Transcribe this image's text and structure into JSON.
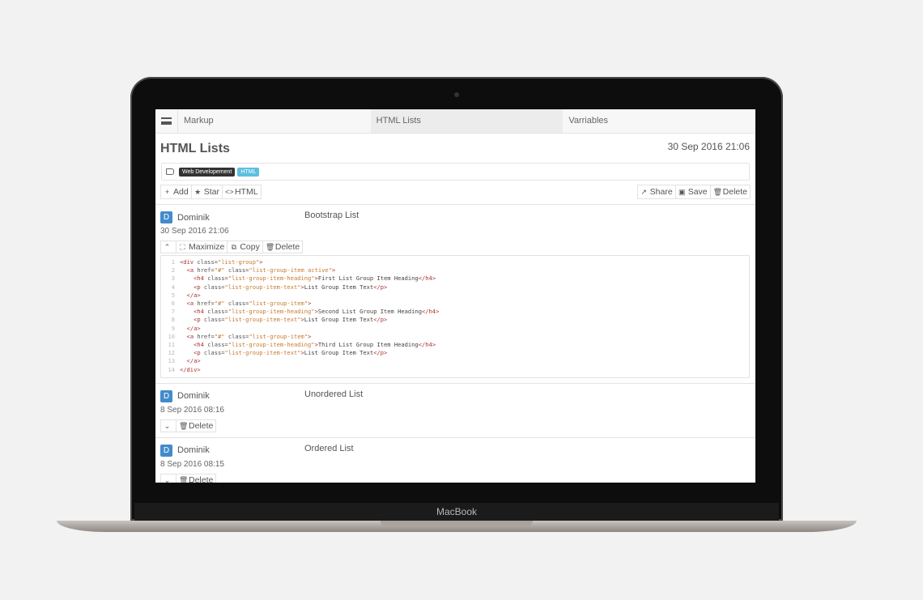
{
  "device": {
    "brand_label": "MacBook"
  },
  "nav": {
    "tabs": [
      {
        "label": "Markup"
      },
      {
        "label": "HTML Lists"
      },
      {
        "label": "Varriables"
      }
    ]
  },
  "page": {
    "title": "HTML Lists",
    "date": "30 Sep 2016 21:06"
  },
  "tags": [
    "Web Developement",
    "HTML"
  ],
  "toolbar": {
    "add": "Add",
    "star": "Star",
    "html": "HTML",
    "share": "Share",
    "save": "Save",
    "delete": "Delete"
  },
  "entries": [
    {
      "avatar": "D",
      "author": "Dominik",
      "title": "Bootstrap List",
      "date": "30 Sep 2016 21:06",
      "tools": {
        "maximize": "Maximize",
        "copy": "Copy",
        "delete": "Delete"
      },
      "code_lines": [
        "<div class=\"list-group\">",
        "  <a href=\"#\" class=\"list-group-item active\">",
        "    <h4 class=\"list-group-item-heading\">First List Group Item Heading</h4>",
        "    <p class=\"list-group-item-text\">List Group Item Text</p>",
        "  </a>",
        "  <a href=\"#\" class=\"list-group-item\">",
        "    <h4 class=\"list-group-item-heading\">Second List Group Item Heading</h4>",
        "    <p class=\"list-group-item-text\">List Group Item Text</p>",
        "  </a>",
        "  <a href=\"#\" class=\"list-group-item\">",
        "    <h4 class=\"list-group-item-heading\">Third List Group Item Heading</h4>",
        "    <p class=\"list-group-item-text\">List Group Item Text</p>",
        "  </a>",
        "</div>"
      ]
    },
    {
      "avatar": "D",
      "author": "Dominik",
      "title": "Unordered List",
      "date": "8 Sep 2016 08:16",
      "tools": {
        "delete": "Delete"
      }
    },
    {
      "avatar": "D",
      "author": "Dominik",
      "title": "Ordered List",
      "date": "8 Sep 2016 08:15",
      "tools": {
        "delete": "Delete"
      }
    }
  ]
}
